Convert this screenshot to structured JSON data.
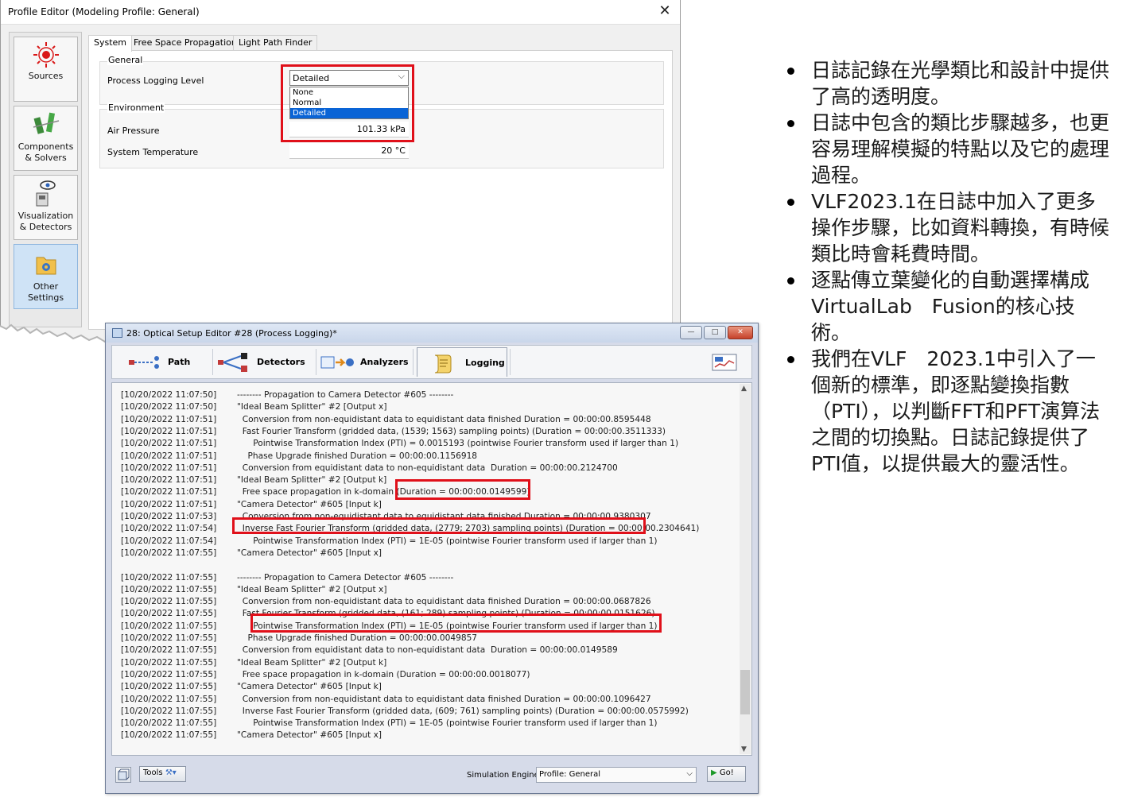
{
  "profile_editor": {
    "title": "Profile Editor (Modeling Profile: General)",
    "close_glyph": "✕",
    "sidebar": [
      {
        "label": "Sources",
        "icon": "laser-source-icon"
      },
      {
        "label": "Components & Solvers",
        "icon": "components-icon"
      },
      {
        "label": "Visualization & Detectors",
        "icon": "eye-detector-icon"
      },
      {
        "label": "Other Settings",
        "icon": "folder-gear-icon",
        "active": true
      }
    ],
    "tabs": [
      "System",
      "Free Space Propagation",
      "Light Path Finder"
    ],
    "selected_tab": "System",
    "general": {
      "title": "General",
      "process_logging_label": "Process Logging Level",
      "process_logging_value": "Detailed",
      "options": [
        "None",
        "Normal",
        "Detailed"
      ],
      "highlighted_option": "Detailed"
    },
    "environment": {
      "title": "Environment",
      "air_pressure_label": "Air Pressure",
      "air_pressure_value": "101.33 kPa",
      "temperature_label": "System Temperature",
      "temperature_value": "20 °C"
    }
  },
  "optical_setup_editor": {
    "title": "28: Optical Setup Editor #28 (Process Logging)*",
    "window_buttons": {
      "minimize": "—",
      "maximize": "□",
      "close": "✕"
    },
    "toolbar": [
      {
        "label": "Path",
        "icon": "path-icon"
      },
      {
        "label": "Detectors",
        "icon": "detectors-icon"
      },
      {
        "label": "Analyzers",
        "icon": "analyzers-icon"
      },
      {
        "label": "Logging",
        "icon": "logging-scroll-icon",
        "selected": true
      }
    ],
    "log_lines": [
      {
        "ts": "[10/20/2022 11:07:50]",
        "msg": "-------- Propagation to Camera Detector #605 --------"
      },
      {
        "ts": "[10/20/2022 11:07:50]",
        "msg": "\"Ideal Beam Splitter\" #2 [Output x]"
      },
      {
        "ts": "[10/20/2022 11:07:51]",
        "msg": "  Conversion from non-equidistant data to equidistant data finished Duration = 00:00:00.8595448"
      },
      {
        "ts": "[10/20/2022 11:07:51]",
        "msg": "  Fast Fourier Transform (gridded data, (1539; 1563) sampling points) (Duration = 00:00:00.3511333)"
      },
      {
        "ts": "[10/20/2022 11:07:51]",
        "msg": "      Pointwise Transformation Index (PTI) = 0.0015193 (pointwise Fourier transform used if larger than 1)"
      },
      {
        "ts": "[10/20/2022 11:07:51]",
        "msg": "    Phase Upgrade finished Duration = 00:00:00.1156918"
      },
      {
        "ts": "[10/20/2022 11:07:51]",
        "msg": "  Conversion from equidistant data to non-equidistant data  Duration = 00:00:00.2124700"
      },
      {
        "ts": "[10/20/2022 11:07:51]",
        "msg": "\"Ideal Beam Splitter\" #2 [Output k]"
      },
      {
        "ts": "[10/20/2022 11:07:51]",
        "msg": "  Free space propagation in k-domain (Duration = 00:00:00.0149599)"
      },
      {
        "ts": "[10/20/2022 11:07:51]",
        "msg": "\"Camera Detector\" #605 [Input k]"
      },
      {
        "ts": "[10/20/2022 11:07:53]",
        "msg": "  Conversion from non-equidistant data to equidistant data finished Duration = 00:00:00.9380307"
      },
      {
        "ts": "[10/20/2022 11:07:54]",
        "msg": "  Inverse Fast Fourier Transform (gridded data, (2779; 2703) sampling points) (Duration = 00:00:00.2304641)"
      },
      {
        "ts": "[10/20/2022 11:07:54]",
        "msg": "      Pointwise Transformation Index (PTI) = 1E-05 (pointwise Fourier transform used if larger than 1)"
      },
      {
        "ts": "[10/20/2022 11:07:55]",
        "msg": "\"Camera Detector\" #605 [Input x]"
      },
      {
        "ts": "",
        "msg": ""
      },
      {
        "ts": "[10/20/2022 11:07:55]",
        "msg": "-------- Propagation to Camera Detector #605 --------"
      },
      {
        "ts": "[10/20/2022 11:07:55]",
        "msg": "\"Ideal Beam Splitter\" #2 [Output x]"
      },
      {
        "ts": "[10/20/2022 11:07:55]",
        "msg": "  Conversion from non-equidistant data to equidistant data finished Duration = 00:00:00.0687826"
      },
      {
        "ts": "[10/20/2022 11:07:55]",
        "msg": "  Fast Fourier Transform (gridded data, (161; 289) sampling points) (Duration = 00:00:00.0151626)"
      },
      {
        "ts": "[10/20/2022 11:07:55]",
        "msg": "      Pointwise Transformation Index (PTI) = 1E-05 (pointwise Fourier transform used if larger than 1)"
      },
      {
        "ts": "[10/20/2022 11:07:55]",
        "msg": "    Phase Upgrade finished Duration = 00:00:00.0049857"
      },
      {
        "ts": "[10/20/2022 11:07:55]",
        "msg": "  Conversion from equidistant data to non-equidistant data  Duration = 00:00:00.0149589"
      },
      {
        "ts": "[10/20/2022 11:07:55]",
        "msg": "\"Ideal Beam Splitter\" #2 [Output k]"
      },
      {
        "ts": "[10/20/2022 11:07:55]",
        "msg": "  Free space propagation in k-domain (Duration = 00:00:00.0018077)"
      },
      {
        "ts": "[10/20/2022 11:07:55]",
        "msg": "\"Camera Detector\" #605 [Input k]"
      },
      {
        "ts": "[10/20/2022 11:07:55]",
        "msg": "  Conversion from non-equidistant data to equidistant data finished Duration = 00:00:00.1096427"
      },
      {
        "ts": "[10/20/2022 11:07:55]",
        "msg": "  Inverse Fast Fourier Transform (gridded data, (609; 761) sampling points) (Duration = 00:00:00.0575992)"
      },
      {
        "ts": "[10/20/2022 11:07:55]",
        "msg": "      Pointwise Transformation Index (PTI) = 1E-05 (pointwise Fourier transform used if larger than 1)"
      },
      {
        "ts": "[10/20/2022 11:07:55]",
        "msg": "\"Camera Detector\" #605 [Input x]"
      }
    ],
    "status": {
      "tools_label": "Tools",
      "engine_label": "Simulation Engine",
      "engine_value": "Profile: General",
      "go_label": "Go!"
    }
  },
  "notes": [
    "日誌記錄在光學類比和設計中提供了高的透明度。",
    "日誌中包含的類比步驟越多，也更容易理解模擬的特點以及它的處理過程。",
    "VLF2023.1在日誌中加入了更多操作步驟，比如資料轉換，有時候類比時會耗費時間。",
    "逐點傳立葉變化的自動選擇構成VirtualLab　Fusion的核心技術。",
    "我們在VLF　2023.1中引入了一個新的標準，即逐點變換指數（PTI），以判斷FFT和PFT演算法之間的切換點。日誌記錄提供了PTI值，以提供最大的靈活性。"
  ],
  "colors": {
    "highlight_box": "#e0101a",
    "selection": "#0a64d6"
  }
}
